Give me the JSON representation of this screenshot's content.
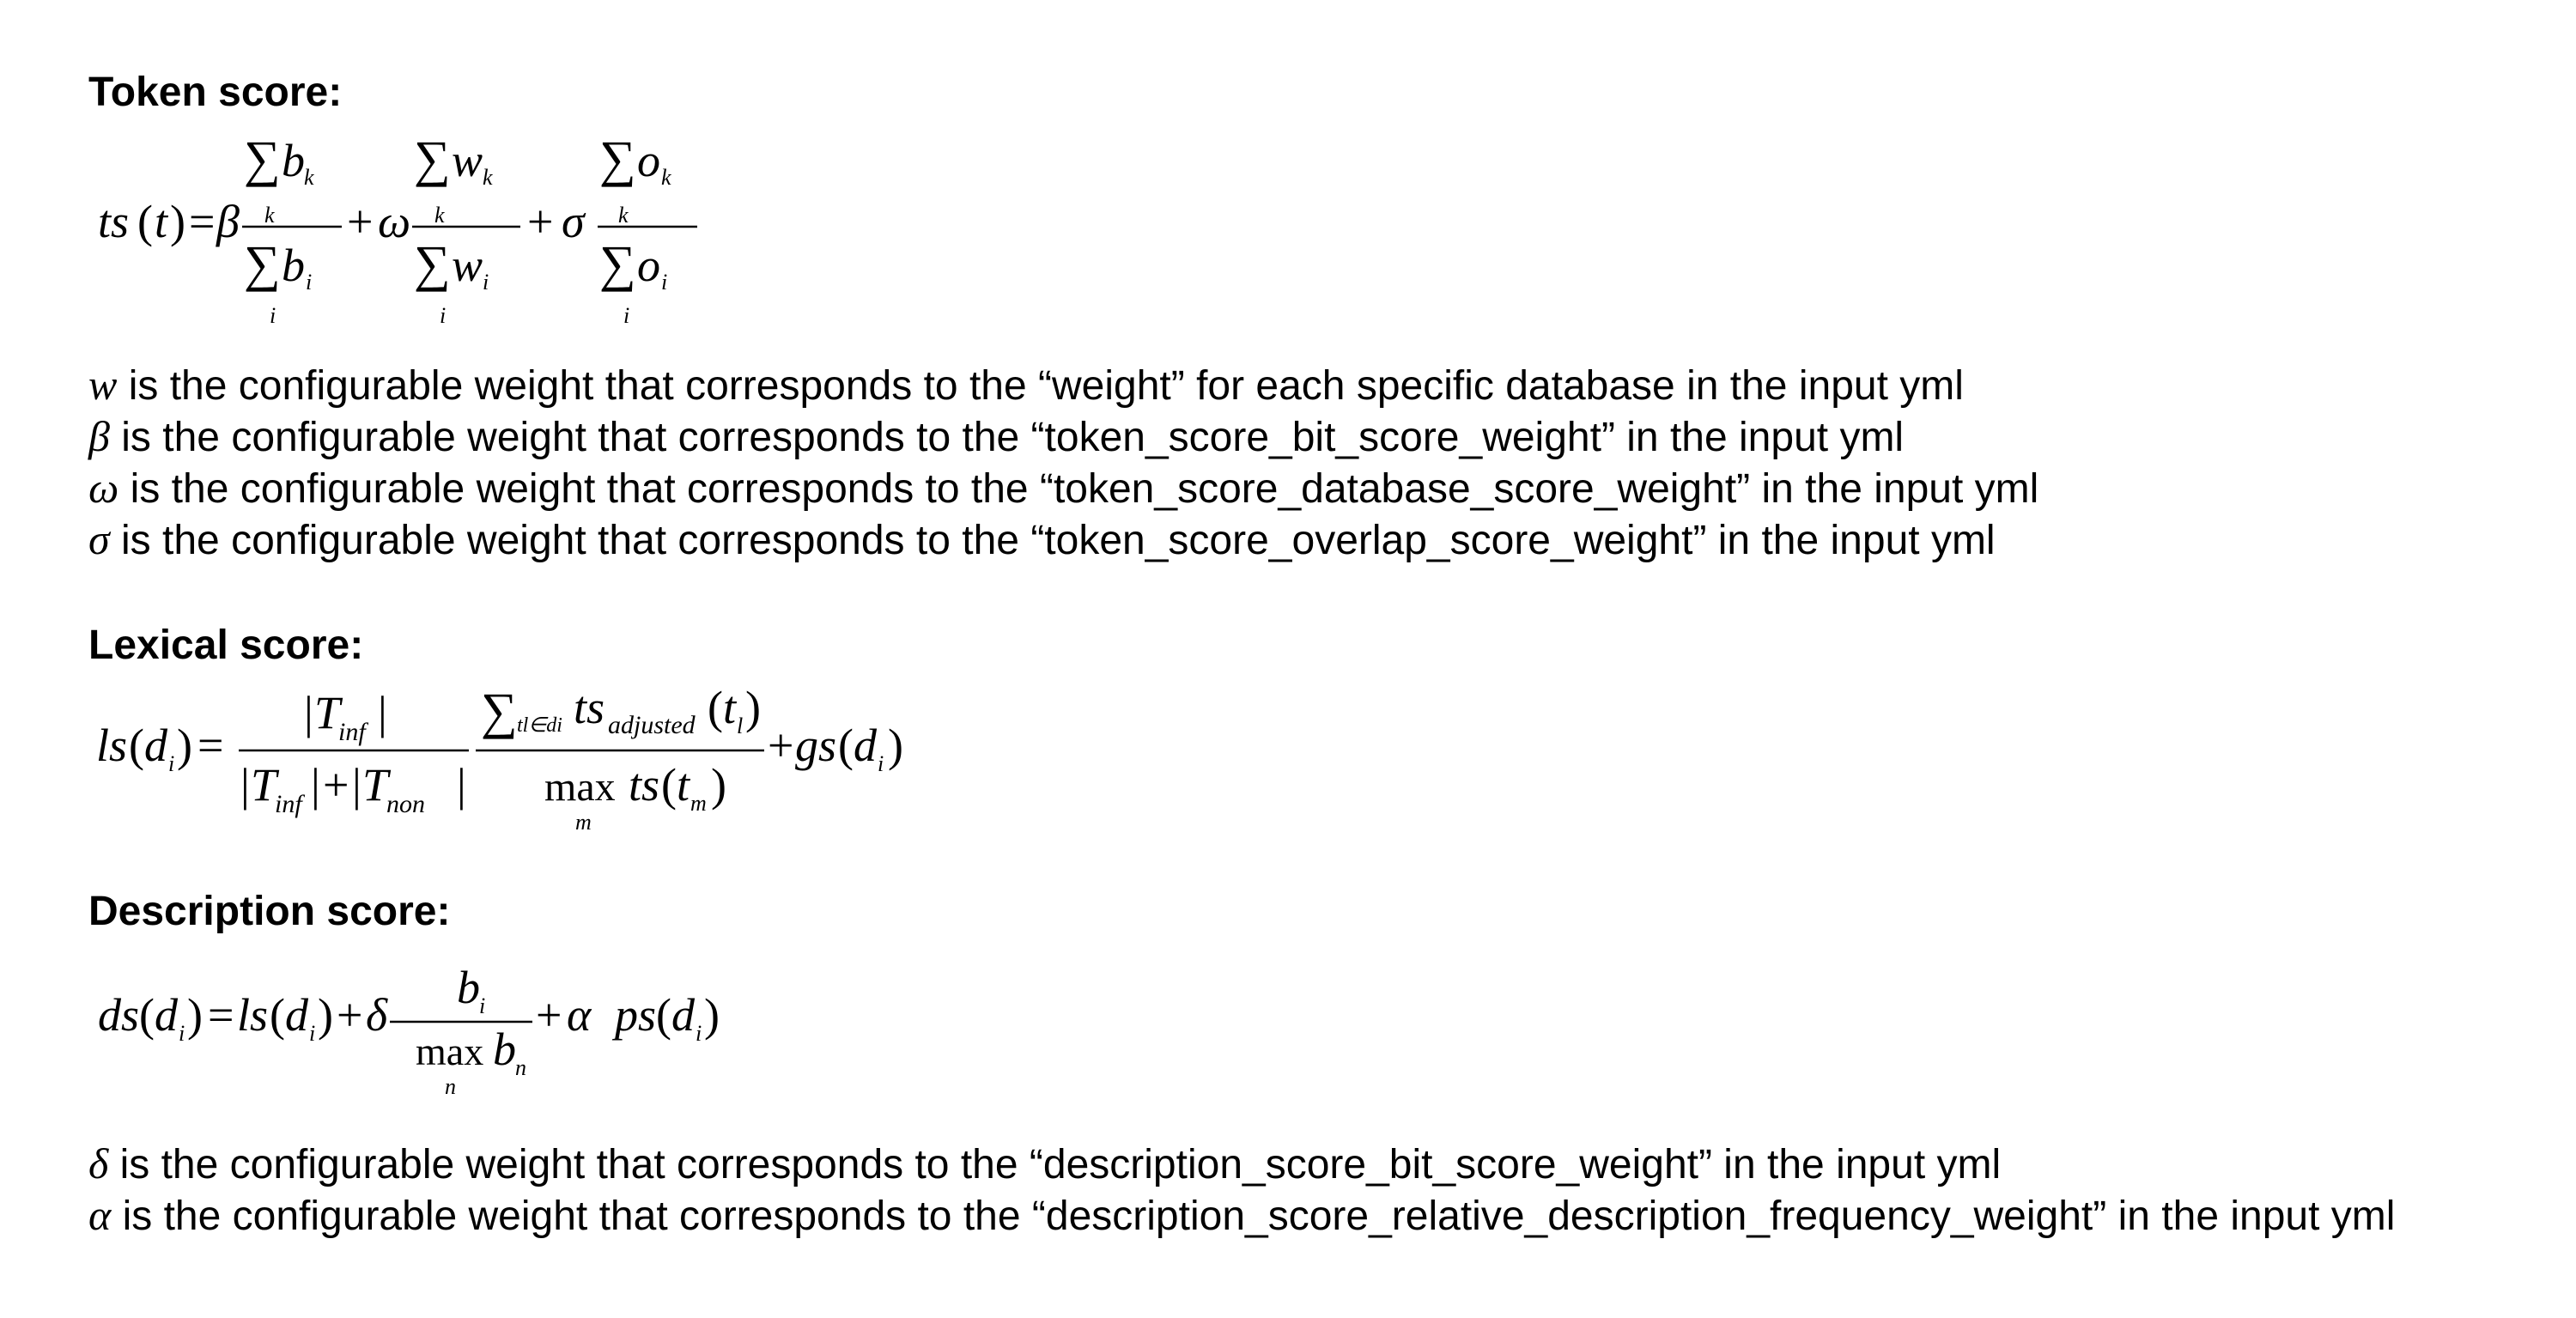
{
  "sections": {
    "token": {
      "heading": "Token score:",
      "formula": {
        "lhs_fn": "ts",
        "lhs_open": "(",
        "lhs_var": "t",
        "lhs_close": ")",
        "equals": "=",
        "coef1": "β",
        "coef2": "ω",
        "coef3": "σ",
        "plus": "+",
        "sum": "∑",
        "num1_var": "b",
        "num2_var": "w",
        "num3_var": "o",
        "den1_var": "b",
        "den2_var": "w",
        "den3_var": "o",
        "num_sub": "k",
        "den_sub": "i"
      },
      "definitions": [
        {
          "symbol": "w",
          "text": "is the configurable weight that corresponds to the “weight” for each specific database in the input yml"
        },
        {
          "symbol": "β",
          "text": "is the configurable weight that corresponds to the “token_score_bit_score_weight” in the input yml"
        },
        {
          "symbol": "ω",
          "text": "is the configurable weight that corresponds to the “token_score_database_score_weight” in the input yml"
        },
        {
          "symbol": "σ",
          "text": "is the configurable weight that corresponds to the “token_score_overlap_score_weight” in the input yml"
        }
      ]
    },
    "lexical": {
      "heading": "Lexical score:",
      "formula": {
        "lhs_fn": "ls",
        "lhs_var": "d",
        "lhs_sub": "i",
        "equals": "=",
        "bar": "|",
        "T": "T",
        "inf": "inf",
        "non": "non",
        "plus": "+",
        "sum": "∑",
        "sum_sub": "tl∈di",
        "ts": "ts",
        "adjusted": "adjusted",
        "tvar": "t",
        "tsub": "l",
        "max": "max",
        "max_sub": "m",
        "den_ts": "ts",
        "den_var": "t",
        "den_sub": "m",
        "gs": "gs",
        "gs_var": "d",
        "gs_sub": "i",
        "open": "(",
        "close": ")"
      }
    },
    "description": {
      "heading": "Description score:",
      "formula": {
        "lhs_fn": "ds",
        "lhs_var": "d",
        "lhs_sub": "i",
        "equals": "=",
        "ls": "ls",
        "ls_var": "d",
        "ls_sub": "i",
        "delta": "δ",
        "plus": "+",
        "num_var": "b",
        "num_sub": "i",
        "max": "max",
        "max_sub": "n",
        "den_var": "b",
        "den_sub": "n",
        "alpha": "α",
        "ps": "ps",
        "ps_var": "d",
        "ps_sub": "i",
        "open": "(",
        "close": ")"
      },
      "definitions": [
        {
          "symbol": "δ",
          "text": "is the configurable weight that corresponds to the “description_score_bit_score_weight” in the input yml"
        },
        {
          "symbol": "α",
          "text": "is the configurable weight that corresponds to the “description_score_relative_description_frequency_weight” in the input yml"
        }
      ]
    }
  }
}
